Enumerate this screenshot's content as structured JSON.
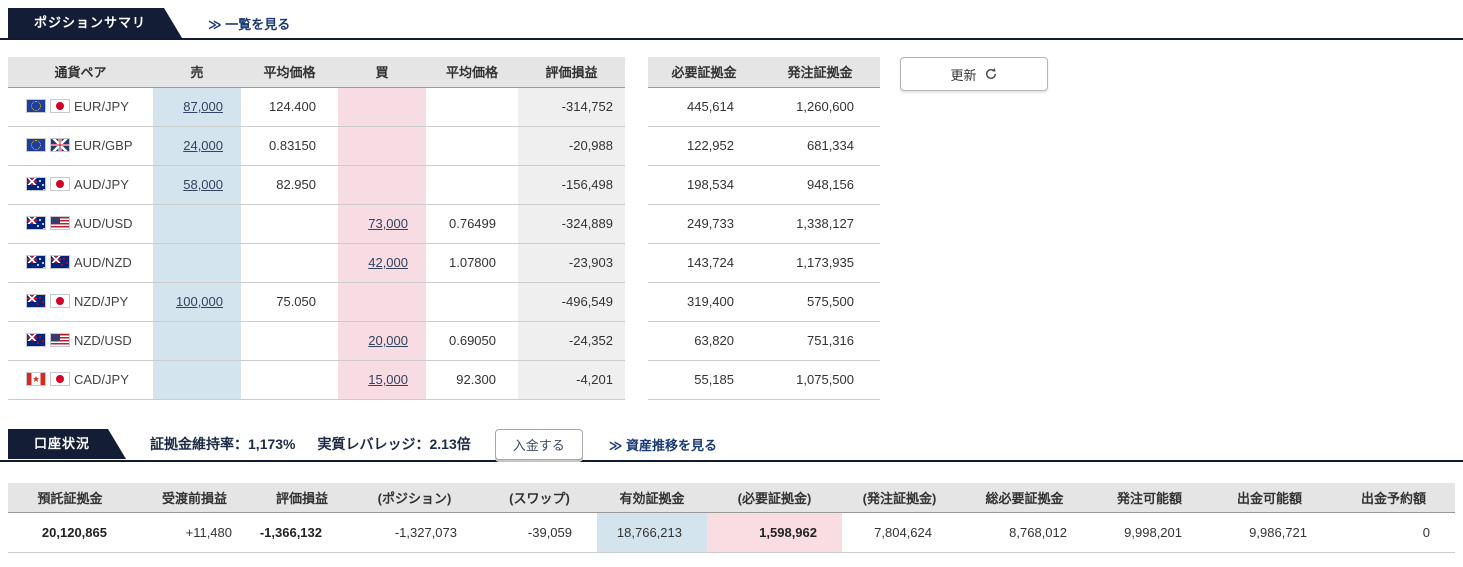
{
  "position_summary": {
    "tab": "ポジションサマリ",
    "view_list_link": "≫ 一覧を見る",
    "refresh_button": "更新",
    "headers": [
      "通貨ペア",
      "売",
      "平均価格",
      "買",
      "平均価格",
      "評価損益"
    ],
    "margin_headers": [
      "必要証拠金",
      "発注証拠金"
    ],
    "rows": [
      {
        "pair": "EUR/JPY",
        "flags": [
          "eu-flag",
          "jp-flag"
        ],
        "sell": "87,000",
        "sell_avg": "124.400",
        "buy": "",
        "buy_avg": "",
        "pl": "-314,752",
        "required_margin": "445,614",
        "order_margin": "1,260,600"
      },
      {
        "pair": "EUR/GBP",
        "flags": [
          "eu-flag",
          "gb-flag"
        ],
        "sell": "24,000",
        "sell_avg": "0.83150",
        "buy": "",
        "buy_avg": "",
        "pl": "-20,988",
        "required_margin": "122,952",
        "order_margin": "681,334"
      },
      {
        "pair": "AUD/JPY",
        "flags": [
          "au-flag",
          "jp-flag"
        ],
        "sell": "58,000",
        "sell_avg": "82.950",
        "buy": "",
        "buy_avg": "",
        "pl": "-156,498",
        "required_margin": "198,534",
        "order_margin": "948,156"
      },
      {
        "pair": "AUD/USD",
        "flags": [
          "au-flag",
          "us-flag"
        ],
        "sell": "",
        "sell_avg": "",
        "buy": "73,000",
        "buy_avg": "0.76499",
        "pl": "-324,889",
        "required_margin": "249,733",
        "order_margin": "1,338,127"
      },
      {
        "pair": "AUD/NZD",
        "flags": [
          "au-flag",
          "nz-flag"
        ],
        "sell": "",
        "sell_avg": "",
        "buy": "42,000",
        "buy_avg": "1.07800",
        "pl": "-23,903",
        "required_margin": "143,724",
        "order_margin": "1,173,935"
      },
      {
        "pair": "NZD/JPY",
        "flags": [
          "nz-flag",
          "jp-flag"
        ],
        "sell": "100,000",
        "sell_avg": "75.050",
        "buy": "",
        "buy_avg": "",
        "pl": "-496,549",
        "required_margin": "319,400",
        "order_margin": "575,500"
      },
      {
        "pair": "NZD/USD",
        "flags": [
          "nz-flag",
          "us-flag"
        ],
        "sell": "",
        "sell_avg": "",
        "buy": "20,000",
        "buy_avg": "0.69050",
        "pl": "-24,352",
        "required_margin": "63,820",
        "order_margin": "751,316"
      },
      {
        "pair": "CAD/JPY",
        "flags": [
          "ca-flag",
          "jp-flag"
        ],
        "sell": "",
        "sell_avg": "",
        "buy": "15,000",
        "buy_avg": "92.300",
        "pl": "-4,201",
        "required_margin": "55,185",
        "order_margin": "1,075,500"
      }
    ]
  },
  "account_status": {
    "tab": "口座状況",
    "margin_maintenance_rate": "証拠金維持率：1,173%",
    "effective_leverage": "実質レバレッジ：2.13倍",
    "deposit_button": "入金する",
    "asset_history_link": "≫ 資産推移を見る",
    "headers": [
      "預託証拠金",
      "受渡前損益",
      "評価損益",
      "(ポジション)",
      "(スワップ)",
      "有効証拠金",
      "(必要証拠金)",
      "(発注証拠金)",
      "総必要証拠金",
      "発注可能額",
      "出金可能額",
      "出金予約額"
    ],
    "values": [
      "20,120,865",
      "+11,480",
      "-1,366,132",
      "-1,327,073",
      "-39,059",
      "18,766,213",
      "1,598,962",
      "7,804,624",
      "8,768,012",
      "9,998,201",
      "9,986,721",
      "0"
    ]
  },
  "colors": {
    "tab_background": "#131e36",
    "link_navy": "#1b3a74",
    "sell_column_bg": "#d4e4ee",
    "buy_column_bg": "#f8dce3",
    "pl_column_bg": "#efefef",
    "header_row_bg": "#e5e5e5"
  }
}
